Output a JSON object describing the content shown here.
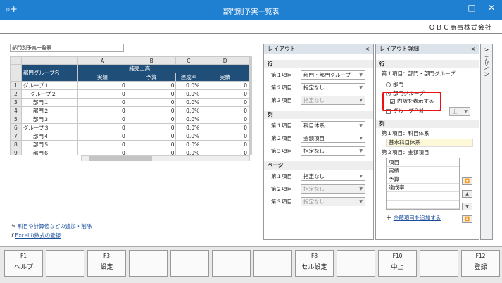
{
  "window": {
    "title": "部門別予実一覧表",
    "icon": "search-plus-icon",
    "min": "—",
    "max": "□",
    "close": "✕"
  },
  "company": "ＯＢＣ商事株式会社",
  "report_name": "部門別予実一覧表",
  "sheet": {
    "col_letters": [
      "A",
      "B",
      "C",
      "D"
    ],
    "group_header": "部門グループ名",
    "sales_header": "純売上高",
    "sub_headers": [
      "実績",
      "予算",
      "達成率",
      "実績"
    ],
    "rows": [
      {
        "n": "1",
        "name": "グループ１",
        "v": [
          "0",
          "0",
          "0.0%",
          "0"
        ]
      },
      {
        "n": "2",
        "name": "グループ２",
        "v": [
          "0",
          "0",
          "0.0%",
          "0"
        ]
      },
      {
        "n": "3",
        "name": "部門１",
        "v": [
          "0",
          "0",
          "0.0%",
          "0"
        ]
      },
      {
        "n": "4",
        "name": "部門２",
        "v": [
          "0",
          "0",
          "0.0%",
          "0"
        ]
      },
      {
        "n": "5",
        "name": "部門３",
        "v": [
          "0",
          "0",
          "0.0%",
          "0"
        ]
      },
      {
        "n": "6",
        "name": "グループ３",
        "v": [
          "0",
          "0",
          "0.0%",
          "0"
        ]
      },
      {
        "n": "7",
        "name": "部門４",
        "v": [
          "0",
          "0",
          "0.0%",
          "0"
        ]
      },
      {
        "n": "8",
        "name": "部門５",
        "v": [
          "0",
          "0",
          "0.0%",
          "0"
        ]
      },
      {
        "n": "9",
        "name": "部門６",
        "v": [
          "0",
          "0",
          "0.0%",
          "0"
        ]
      }
    ]
  },
  "links": {
    "add_items": "科目や計算値などの追加・削除",
    "excel": "Excelの数式の登録"
  },
  "layout": {
    "title": "レイアウト",
    "chev": "<",
    "row_section": "行",
    "col_section": "列",
    "page_section": "ページ",
    "item_labels": [
      "第１項目",
      "第２項目",
      "第３項目"
    ],
    "row_values": [
      "部門・部門グループ",
      "指定なし",
      "指定なし"
    ],
    "col_values": [
      "科目体系",
      "金額項目",
      "指定なし"
    ],
    "page_values": [
      "指定なし",
      "指定なし",
      "指定なし"
    ]
  },
  "detail": {
    "title": "レイアウト詳細",
    "chev": "<",
    "row_section": "行",
    "row_item": "第１項目：部門・部門グループ",
    "radio_dept": "部門",
    "radio_group": "部門グループ",
    "show_breakdown": "内訳を表示する",
    "group_total": "グループ合計",
    "position": "上",
    "col_section": "列",
    "col_item1": "第１項目：科目体系",
    "col_item1_value": "基本科目体系",
    "col_item2": "第２項目：金額項目",
    "list": [
      "項目",
      "実績",
      "予算",
      "達成率"
    ],
    "add_amount": "金額項目を追加する"
  },
  "side_tab": {
    "chev": ">",
    "label": "デザイン"
  },
  "fkeys": [
    {
      "k": "F1",
      "l": "ヘルプ"
    },
    {
      "k": "",
      "l": ""
    },
    {
      "k": "F3",
      "l": "設定"
    },
    {
      "k": "",
      "l": ""
    },
    {
      "k": "",
      "l": ""
    },
    {
      "k": "",
      "l": ""
    },
    {
      "k": "",
      "l": ""
    },
    {
      "k": "F8",
      "l": "セル設定"
    },
    {
      "k": "",
      "l": ""
    },
    {
      "k": "F10",
      "l": "中止"
    },
    {
      "k": "",
      "l": ""
    },
    {
      "k": "F12",
      "l": "登録"
    }
  ]
}
